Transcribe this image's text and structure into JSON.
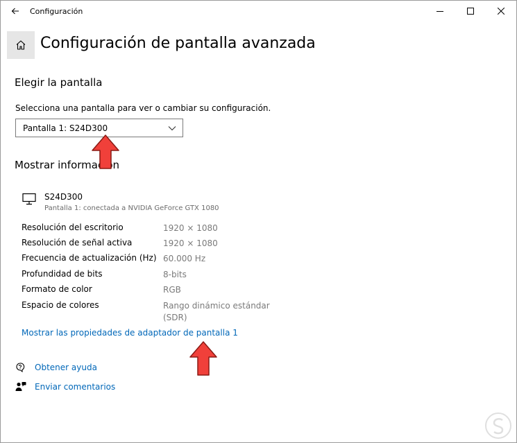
{
  "window": {
    "app_title": "Configuración"
  },
  "header": {
    "page_title": "Configuración de pantalla avanzada"
  },
  "choose_display": {
    "section_title": "Elegir la pantalla",
    "description": "Selecciona una pantalla para ver o cambiar su configuración.",
    "selected": "Pantalla 1: S24D300"
  },
  "display_info": {
    "section_title": "Mostrar información",
    "monitor_name": "S24D300",
    "monitor_sub": "Pantalla 1: conectada a NVIDIA GeForce GTX 1080",
    "rows": [
      {
        "label": "Resolución del escritorio",
        "value": "1920 × 1080"
      },
      {
        "label": "Resolución de señal activa",
        "value": "1920 × 1080"
      },
      {
        "label": "Frecuencia de actualización (Hz)",
        "value": "60.000 Hz"
      },
      {
        "label": "Profundidad de bits",
        "value": "8-bits"
      },
      {
        "label": "Formato de color",
        "value": "RGB"
      },
      {
        "label": "Espacio de colores",
        "value": "Rango dinámico estándar (SDR)"
      }
    ],
    "adapter_link": "Mostrar las propiedades de adaptador de pantalla 1"
  },
  "help": {
    "get_help": "Obtener ayuda",
    "feedback": "Enviar comentarios"
  },
  "colors": {
    "link": "#0067b8",
    "arrow_fill": "#f0403a",
    "arrow_stroke": "#8a1a14",
    "home_bg": "#e6e6e6"
  },
  "icons": [
    "back-arrow-icon",
    "minimize-icon",
    "maximize-icon",
    "close-icon",
    "home-icon",
    "chevron-down-icon",
    "monitor-icon",
    "help-icon",
    "feedback-icon",
    "red-arrow-icon"
  ]
}
